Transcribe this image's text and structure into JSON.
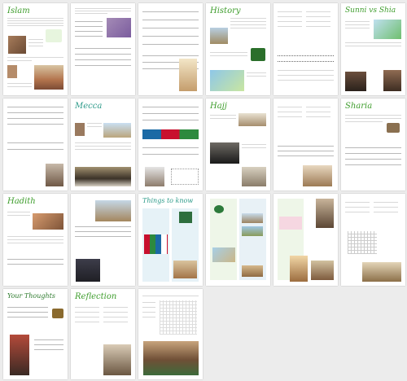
{
  "pages": [
    {
      "title": "Islam",
      "color": "#5cae33"
    },
    {
      "title": "",
      "color": "#5cae33"
    },
    {
      "title": "",
      "color": "#5cae33"
    },
    {
      "title": "History",
      "color": "#5cae33"
    },
    {
      "title": "",
      "color": "#5cae33"
    },
    {
      "title": "Sunni vs Shia",
      "color": "#5cae33"
    },
    {
      "title": "",
      "color": "#5cae33"
    },
    {
      "title": "Mecca",
      "color": "#2e9b8a"
    },
    {
      "title": "",
      "color": "#5cae33"
    },
    {
      "title": "Hajj",
      "color": "#5cae33"
    },
    {
      "title": "",
      "color": "#5cae33"
    },
    {
      "title": "Sharia",
      "color": "#5cae33"
    },
    {
      "title": "Hadith",
      "color": "#5cae33"
    },
    {
      "title": "",
      "color": "#5cae33"
    },
    {
      "title": "Things to know",
      "color": "#2e9b8a"
    },
    {
      "title": "",
      "color": "#5cae33"
    },
    {
      "title": "",
      "color": "#5cae33"
    },
    {
      "title": "",
      "color": "#5cae33"
    },
    {
      "title": "Your Thoughts",
      "color": "#2d7a2d"
    },
    {
      "title": "Reflection",
      "color": "#5cae33"
    },
    {
      "title": "",
      "color": "#5cae33"
    }
  ]
}
